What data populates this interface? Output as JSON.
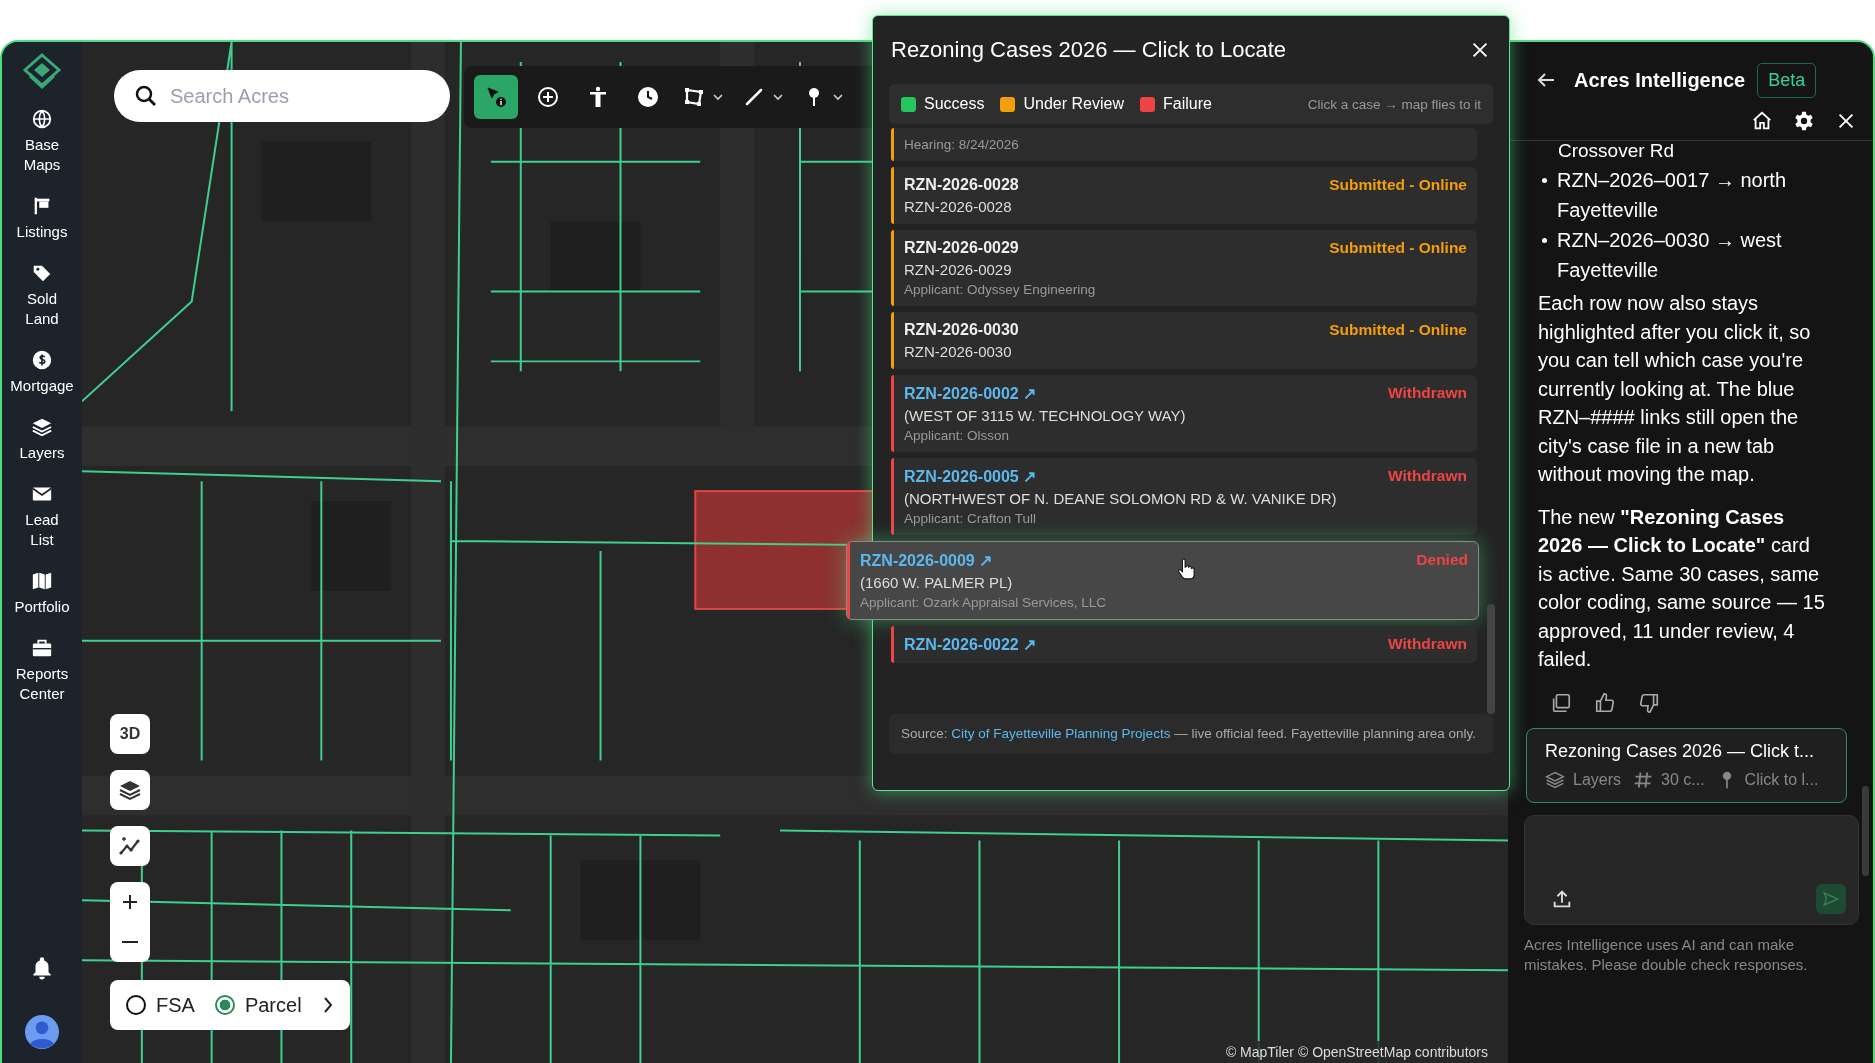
{
  "sidebar": {
    "items": [
      {
        "label": "Base Maps"
      },
      {
        "label": "Listings"
      },
      {
        "label": "Sold Land"
      },
      {
        "label": "Mortgage"
      },
      {
        "label": "Layers"
      },
      {
        "label": "Lead List"
      },
      {
        "label": "Portfolio"
      },
      {
        "label": "Reports Center"
      }
    ]
  },
  "search": {
    "placeholder": "Search Acres"
  },
  "toolbar": {
    "tools": [
      {
        "selected": true,
        "menu": false
      },
      {
        "selected": false,
        "menu": false
      },
      {
        "selected": false,
        "menu": false
      },
      {
        "selected": false,
        "menu": false
      },
      {
        "selected": false,
        "menu": true
      },
      {
        "selected": false,
        "menu": true
      },
      {
        "selected": false,
        "menu": true
      }
    ]
  },
  "map_controls": {
    "view_3d": "3D"
  },
  "layer_toggle": {
    "options": [
      {
        "label": "FSA",
        "selected": false
      },
      {
        "label": "Parcel",
        "selected": true
      }
    ]
  },
  "attribution": "© MapTiler © OpenStreetMap contributors",
  "panel": {
    "title": "Rezoning Cases 2026 — Click to Locate",
    "legend": [
      {
        "label": "Success",
        "color": "#22c55e"
      },
      {
        "label": "Under Review",
        "color": "#f59e0b"
      },
      {
        "label": "Failure",
        "color": "#ef4444"
      }
    ],
    "hint": "Click a case → map flies to it",
    "cases": [
      {
        "hearing": "Hearing: 8/24/2026",
        "color": "#f59e0b",
        "selected": false
      },
      {
        "id": "RZN-2026-0028",
        "link": false,
        "status": "Submitted - Online",
        "address": "RZN-2026-0028",
        "color": "#f59e0b",
        "selected": false
      },
      {
        "id": "RZN-2026-0029",
        "link": false,
        "status": "Submitted - Online",
        "address": "RZN-2026-0029",
        "applicant": "Applicant: Odyssey Engineering",
        "color": "#f59e0b",
        "selected": false
      },
      {
        "id": "RZN-2026-0030",
        "link": false,
        "status": "Submitted - Online",
        "address": "RZN-2026-0030",
        "color": "#f59e0b",
        "selected": false
      },
      {
        "id": "RZN-2026-0002 ↗",
        "link": true,
        "status": "Withdrawn",
        "address": "(WEST OF 3115 W. TECHNOLOGY WAY)",
        "applicant": "Applicant: Olsson",
        "color": "#ef4444",
        "selected": false
      },
      {
        "id": "RZN-2026-0005 ↗",
        "link": true,
        "status": "Withdrawn",
        "address": "(NORTHWEST OF N. DEANE SOLOMON RD & W. VANIKE DR)",
        "applicant": "Applicant: Crafton Tull",
        "color": "#ef4444",
        "selected": false
      },
      {
        "id": "RZN-2026-0009 ↗",
        "link": true,
        "status": "Denied",
        "address": "(1660 W. PALMER PL)",
        "applicant": "Applicant: Ozark Appraisal Services, LLC",
        "color": "#ef4444",
        "selected": true
      },
      {
        "id": "RZN-2026-0022 ↗",
        "link": true,
        "status": "Withdrawn",
        "color": "#ef4444",
        "selected": false
      }
    ],
    "source": {
      "prefix": "Source: ",
      "link": "City of Fayetteville Planning Projects",
      "suffix": " — live official feed. Fayetteville planning area only."
    }
  },
  "chat": {
    "title": "Acres Intelligence",
    "badge": "Beta",
    "continuation": "Crossover Rd",
    "bullets": [
      "RZN–2026–0017 → north Fayetteville",
      "RZN–2026–0030 → west Fayetteville"
    ],
    "paragraphs": [
      "Each row now also stays highlighted after you click it, so you can tell which case you're currently looking at. The blue RZN–#### links still open the city's case file in a new tab without moving the map.",
      "The new **\"Rezoning Cases 2026 — Click to Locate\"** card is active. Same 30 cases, same color coding, same source — 15 approved, 11 under review, 4 failed."
    ],
    "context_card": {
      "title": "Rezoning Cases 2026 — Click t...",
      "meta": [
        "Layers",
        "30 c...",
        "Click to l..."
      ]
    },
    "disclaimer": "Acres Intelligence uses AI and can make mistakes. Please double check responses."
  }
}
